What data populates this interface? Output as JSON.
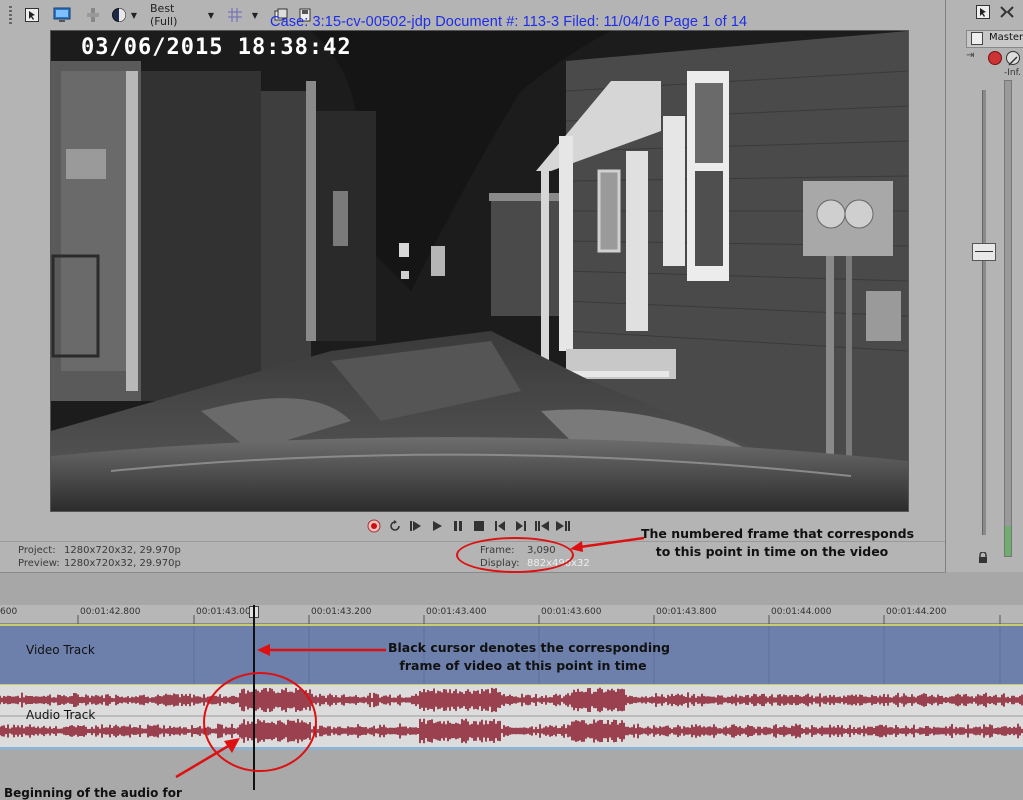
{
  "document_header": "Case: 3:15-cv-00502-jdp   Document #: 113-3   Filed: 11/04/16   Page 1 of 14",
  "toolbar": {
    "quality_label": "Best (Full)"
  },
  "video": {
    "timestamp": "03/06/2015 18:38:42"
  },
  "status": {
    "project_label": "Project:",
    "project_value": "1280x720x32, 29.970p",
    "preview_label": "Preview:",
    "preview_value": "1280x720x32, 29.970p",
    "frame_label": "Frame:",
    "frame_value": "3,090",
    "display_label": "Display:",
    "display_value": "882x496x32"
  },
  "mixer": {
    "title": "Master",
    "inf_label": "-Inf."
  },
  "timeline": {
    "ticks": [
      "600",
      "00:01:42.800",
      "00:01:43.000",
      "00:01:43.200",
      "00:01:43.400",
      "00:01:43.600",
      "00:01:43.800",
      "00:01:44.000",
      "00:01:44.200"
    ],
    "video_track_label": "Video Track",
    "audio_track_label": "Audio Track"
  },
  "annotations": {
    "frame_note_line1": "The numbered frame that corresponds",
    "frame_note_line2": "to this point in time on the video",
    "cursor_note_line1": "Black cursor denotes the corresponding",
    "cursor_note_line2": "frame of video at this point in time",
    "bottom_note": "Beginning of the audio for"
  },
  "colors": {
    "video_track": "#6d7fab",
    "waveform": "#8a1a2c",
    "annotation_red": "#dd1111",
    "header_blue": "#1e2ee6"
  },
  "icons": [
    "snap-icon",
    "monitor-icon",
    "split-icon",
    "color-circle-icon",
    "grid-icon",
    "copy-icon",
    "save-icon",
    "record-icon",
    "loop-icon",
    "play-from-start-icon",
    "play-icon",
    "pause-icon",
    "stop-icon",
    "prev-marker-icon",
    "next-marker-icon",
    "prev-frame-icon",
    "next-frame-icon",
    "lock-icon"
  ]
}
